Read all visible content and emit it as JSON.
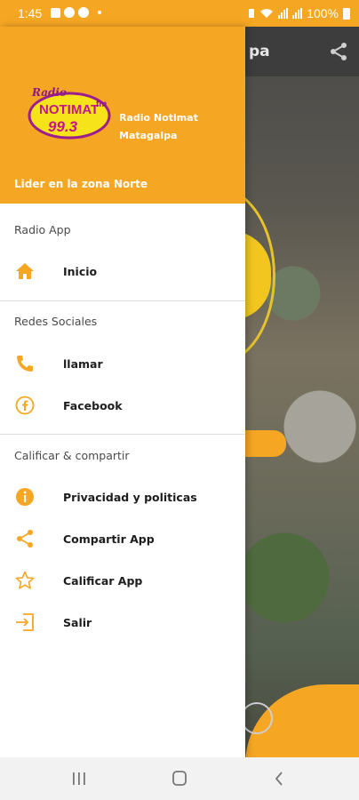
{
  "status_bar": {
    "time": "1:45",
    "battery_text": "100%",
    "icons_left": [
      "gallery-icon",
      "facebook-icon",
      "facebook-icon",
      "dot-icon"
    ],
    "icons_right": [
      "battery-saver-icon",
      "wifi-icon",
      "signal-icon",
      "signal-icon",
      "battery-icon"
    ]
  },
  "background_app": {
    "title_fragment": "pa",
    "share_icon": "share-icon"
  },
  "drawer": {
    "header": {
      "logo": {
        "script": "Radio",
        "brand": "NOTIMAT",
        "frequency": "99.3",
        "band": "fm"
      },
      "station_name_line1": "Radio Notimat",
      "station_name_line2": "Matagalpa",
      "slogan": "Lider en la zona Norte"
    },
    "sections": [
      {
        "title": "Radio App",
        "items": [
          {
            "label": "Inicio",
            "icon": "home-icon"
          }
        ]
      },
      {
        "title": "Redes Sociales",
        "items": [
          {
            "label": "llamar",
            "icon": "phone-icon"
          },
          {
            "label": "Facebook",
            "icon": "facebook-icon"
          }
        ]
      },
      {
        "title": "Calificar & compartir",
        "items": [
          {
            "label": "Privacidad y politicas",
            "icon": "info-icon"
          },
          {
            "label": "Compartir App",
            "icon": "share-icon"
          },
          {
            "label": "Calificar App",
            "icon": "star-icon"
          },
          {
            "label": "Salir",
            "icon": "exit-icon"
          }
        ]
      }
    ]
  },
  "nav_bar": {
    "buttons": [
      "recents-icon",
      "home-button-icon",
      "back-icon"
    ]
  },
  "colors": {
    "accent": "#f5a623",
    "drawer_bg": "#ffffff",
    "text": "#1d1d1d"
  }
}
